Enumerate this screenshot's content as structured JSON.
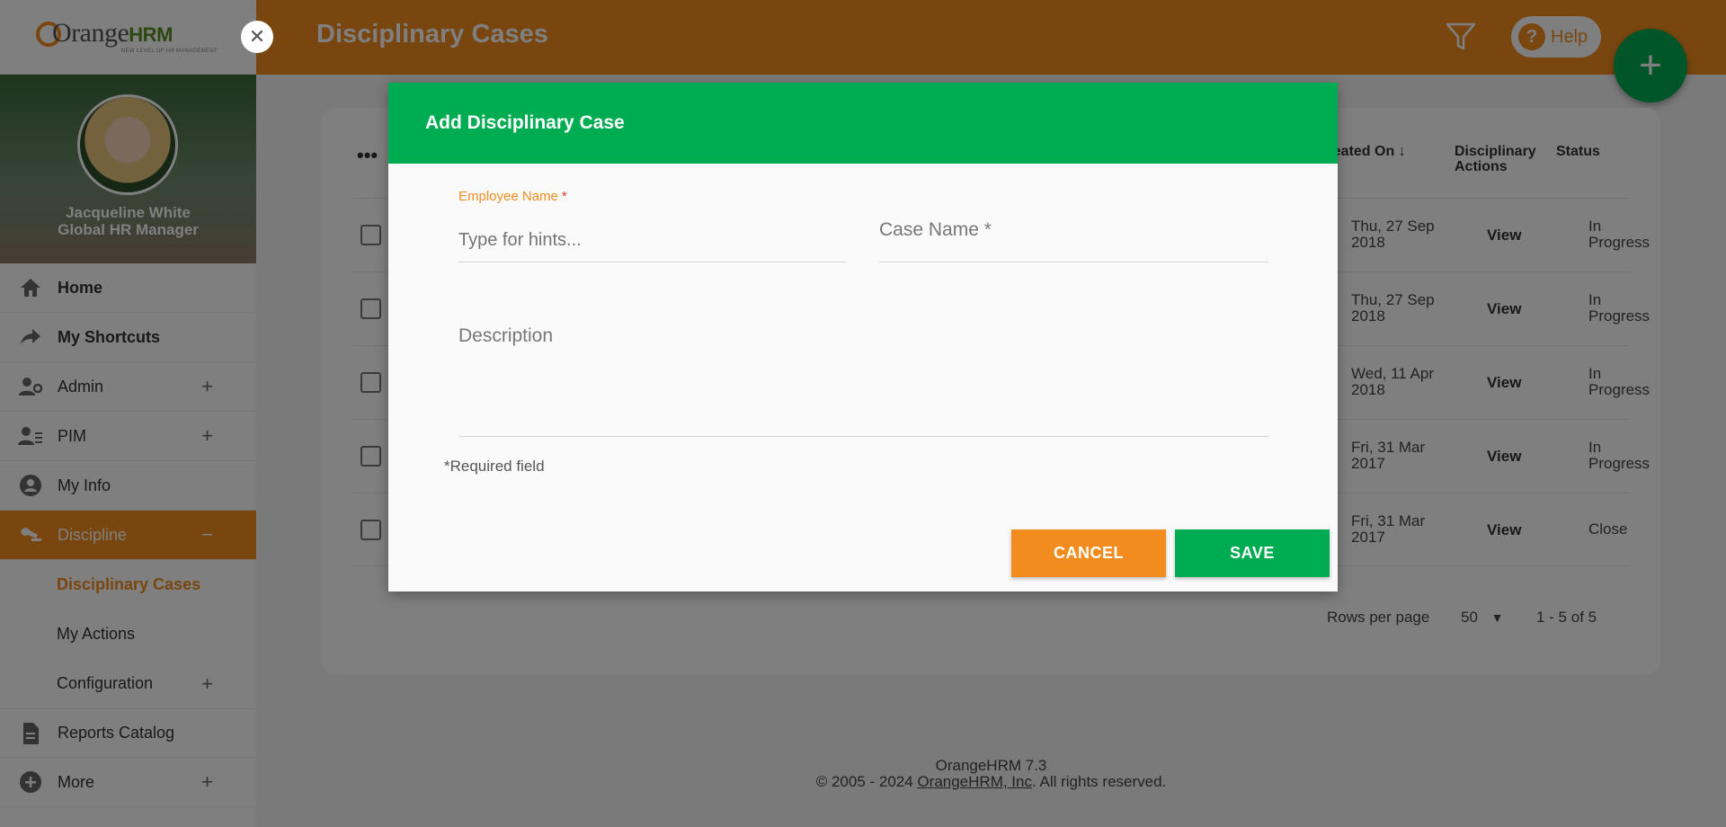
{
  "app": {
    "logo_text": "Orange",
    "logo_hrm": "HRM",
    "logo_tagline": "NEW LEVEL OF HR MANAGEMENT"
  },
  "profile": {
    "name": "Jacqueline White",
    "role": "Global HR Manager"
  },
  "sidebar": {
    "items": [
      {
        "label": "Home",
        "icon": "home-icon"
      },
      {
        "label": "My Shortcuts",
        "icon": "share-icon"
      },
      {
        "label": "Admin",
        "icon": "admin-icon"
      },
      {
        "label": "PIM",
        "icon": "pim-icon"
      },
      {
        "label": "My Info",
        "icon": "user-icon"
      },
      {
        "label": "Discipline",
        "icon": "discipline-icon"
      },
      {
        "label": "Reports Catalog",
        "icon": "document-icon"
      },
      {
        "label": "More",
        "icon": "plus-circle-icon"
      }
    ],
    "sub_items": [
      {
        "label": "Disciplinary Cases"
      },
      {
        "label": "My Actions"
      },
      {
        "label": "Configuration"
      }
    ]
  },
  "header": {
    "title": "Disciplinary Cases",
    "help_label": "Help",
    "help_icon_text": "?",
    "fab_label": "+"
  },
  "table": {
    "more_label": "•••",
    "columns": {
      "created_on": "Created On",
      "sort_arrow": "↓",
      "actions": "Disciplinary Actions",
      "status": "Status"
    },
    "rows": [
      {
        "date": "Thu, 27 Sep 2018",
        "action": "View",
        "status": "In Progress"
      },
      {
        "date": "Thu, 27 Sep 2018",
        "action": "View",
        "status": "In Progress"
      },
      {
        "date": "Wed, 11 Apr 2018",
        "action": "View",
        "status": "In Progress"
      },
      {
        "date": "Fri, 31 Mar 2017",
        "action": "View",
        "status": "In Progress"
      },
      {
        "date": "Fri, 31 Mar 2017",
        "action": "View",
        "status": "Close"
      }
    ],
    "rows_per_page_label": "Rows per page",
    "rows_per_page_value": "50",
    "dropdown_arrow": "▼",
    "range": "1 - 5 of 5"
  },
  "footer": {
    "version": "OrangeHRM 7.3",
    "copyright_prefix": "© 2005 - 2024 ",
    "company_link": "OrangeHRM, Inc",
    "copyright_suffix": ". All rights reserved."
  },
  "modal": {
    "title": "Add Disciplinary Case",
    "employee_label": "Employee Name",
    "employee_placeholder": "Type for hints...",
    "case_label": "Case Name",
    "required_star": "*",
    "description_label": "Description",
    "required_note": "Required field",
    "cancel_label": "CANCEL",
    "save_label": "SAVE"
  },
  "colors": {
    "brand_orange": "#f28c1e",
    "primary_green": "#00ac51"
  }
}
